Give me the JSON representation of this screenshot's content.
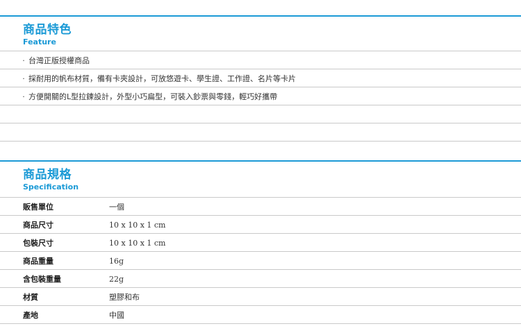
{
  "feature": {
    "title": "商品特色",
    "subtitle": "Feature",
    "items": [
      "台灣正版授權商品",
      "採耐用的帆布材質，備有卡夾設計，可放悠遊卡、學生證、工作證、名片等卡片",
      "方便開關的L型拉鍊設計，外型小巧扁型，可裝入鈔票與零錢，輕巧好攜帶"
    ],
    "bullet": "‧"
  },
  "spec": {
    "title": "商品規格",
    "subtitle": "Specification",
    "rows": [
      {
        "label": "販售單位",
        "value": "一個"
      },
      {
        "label": "商品尺寸",
        "value": "10 x 10 x 1 cm"
      },
      {
        "label": "包裝尺寸",
        "value": "10 x 10 x 1 cm"
      },
      {
        "label": "商品重量",
        "value": "16g"
      },
      {
        "label": "含包裝重量",
        "value": "22g"
      },
      {
        "label": "材質",
        "value": "塑膠和布"
      },
      {
        "label": "產地",
        "value": "中國"
      }
    ]
  },
  "colors": {
    "accent": "#1b9ad6",
    "divider": "#c9c9c9"
  }
}
